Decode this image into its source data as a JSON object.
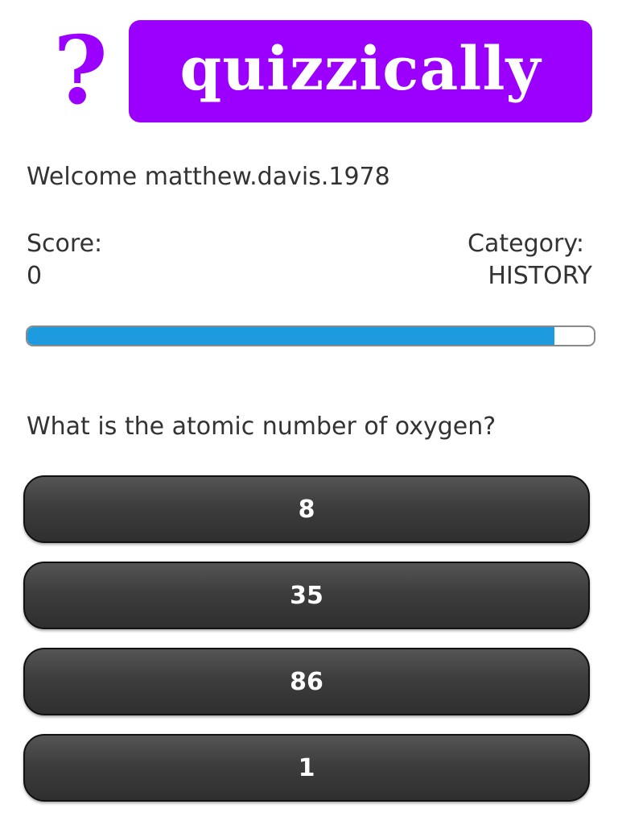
{
  "header": {
    "logo_mark": "?",
    "logo_text": "quizzically",
    "brand_color": "#9b00ff"
  },
  "welcome": {
    "text": "Welcome matthew.davis.1978"
  },
  "stats": {
    "score_label": "Score:",
    "score_value": "0",
    "category_label": "Category:",
    "category_value": "HISTORY"
  },
  "progress": {
    "fraction": 0.93,
    "color": "#1e9bde"
  },
  "question": {
    "text": "What is the atomic number of oxygen?"
  },
  "answers": [
    {
      "label": "8"
    },
    {
      "label": "35"
    },
    {
      "label": "86"
    },
    {
      "label": "1"
    }
  ]
}
